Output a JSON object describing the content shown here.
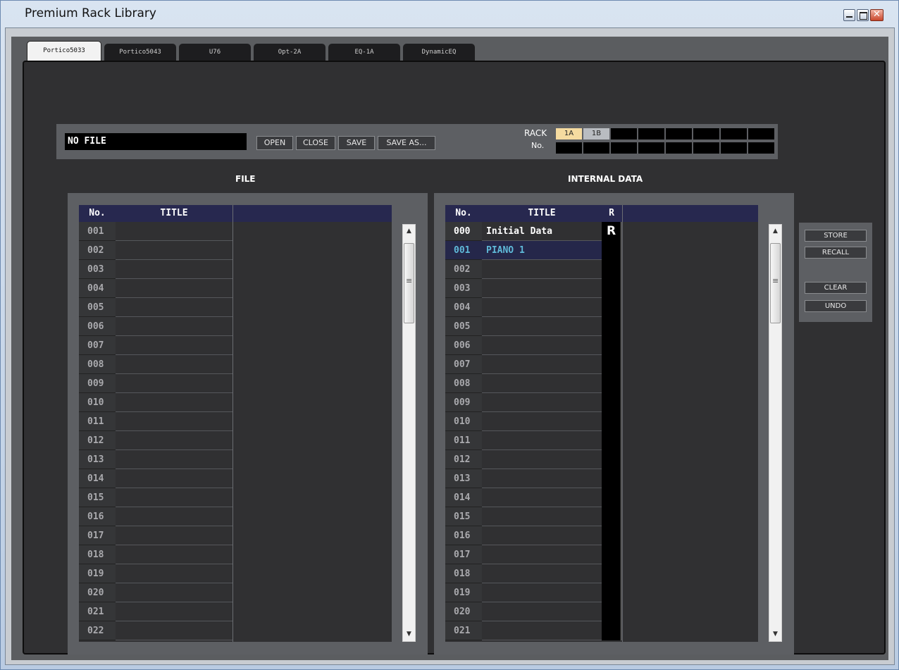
{
  "window": {
    "title": "Premium Rack Library"
  },
  "tabs": [
    {
      "label": "Portico5033",
      "active": true
    },
    {
      "label": "Portico5043"
    },
    {
      "label": "U76"
    },
    {
      "label": "Opt-2A"
    },
    {
      "label": "EQ-1A"
    },
    {
      "label": "DynamicEQ"
    }
  ],
  "file_bar": {
    "filename": "NO FILE",
    "open_label": "OPEN",
    "close_label": "CLOSE",
    "save_label": "SAVE",
    "save_as_label": "SAVE AS..."
  },
  "rack": {
    "rack_label": "RACK",
    "no_label": "No.",
    "slots": [
      "1A",
      "1B"
    ]
  },
  "file_panel": {
    "heading": "FILE",
    "col_no": "No.",
    "col_title": "TITLE",
    "rows": [
      "001",
      "002",
      "003",
      "004",
      "005",
      "006",
      "007",
      "008",
      "009",
      "010",
      "011",
      "012",
      "013",
      "014",
      "015",
      "016",
      "017",
      "018",
      "019",
      "020",
      "021",
      "022"
    ]
  },
  "internal_panel": {
    "heading": "INTERNAL DATA",
    "col_no": "No.",
    "col_title": "TITLE",
    "col_r": "R",
    "rows": [
      {
        "no": "000",
        "title": "Initial Data",
        "r": "R"
      },
      {
        "no": "001",
        "title": "PIANO 1",
        "r": "",
        "selected": true
      },
      {
        "no": "002",
        "title": "",
        "r": ""
      },
      {
        "no": "003",
        "title": "",
        "r": ""
      },
      {
        "no": "004",
        "title": "",
        "r": ""
      },
      {
        "no": "005",
        "title": "",
        "r": ""
      },
      {
        "no": "006",
        "title": "",
        "r": ""
      },
      {
        "no": "007",
        "title": "",
        "r": ""
      },
      {
        "no": "008",
        "title": "",
        "r": ""
      },
      {
        "no": "009",
        "title": "",
        "r": ""
      },
      {
        "no": "010",
        "title": "",
        "r": ""
      },
      {
        "no": "011",
        "title": "",
        "r": ""
      },
      {
        "no": "012",
        "title": "",
        "r": ""
      },
      {
        "no": "013",
        "title": "",
        "r": ""
      },
      {
        "no": "014",
        "title": "",
        "r": ""
      },
      {
        "no": "015",
        "title": "",
        "r": ""
      },
      {
        "no": "016",
        "title": "",
        "r": ""
      },
      {
        "no": "017",
        "title": "",
        "r": ""
      },
      {
        "no": "018",
        "title": "",
        "r": ""
      },
      {
        "no": "019",
        "title": "",
        "r": ""
      },
      {
        "no": "020",
        "title": "",
        "r": ""
      },
      {
        "no": "021",
        "title": "",
        "r": ""
      }
    ]
  },
  "side_buttons": {
    "store_label": "STORE",
    "recall_label": "RECALL",
    "clear_label": "CLEAR",
    "undo_label": "UNDO"
  }
}
